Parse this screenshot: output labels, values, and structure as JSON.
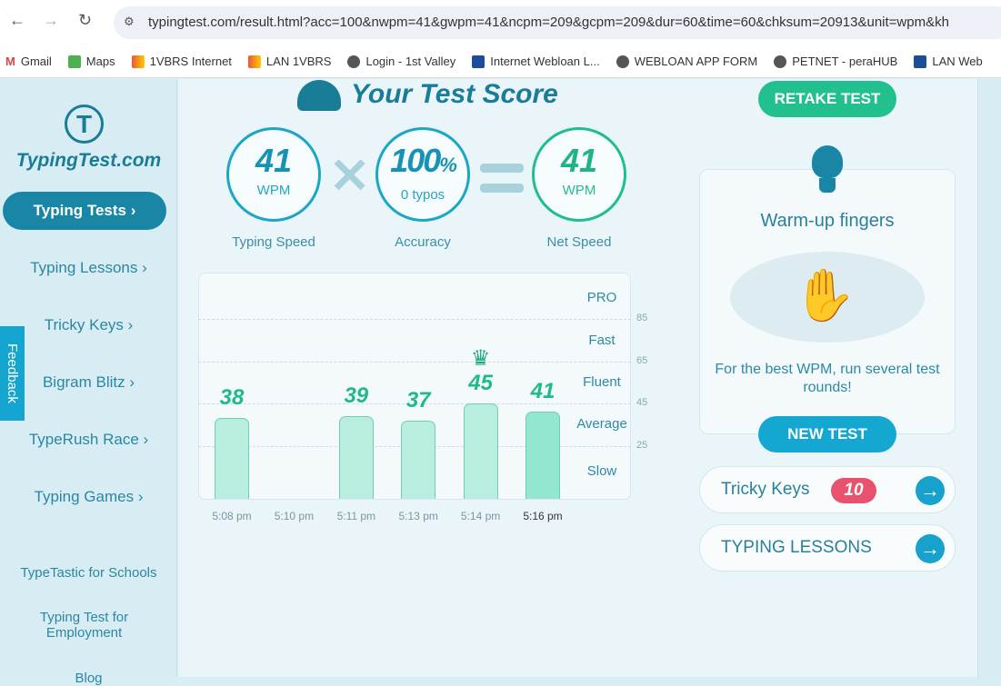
{
  "browser": {
    "url": "typingtest.com/result.html?acc=100&nwpm=41&gwpm=41&ncpm=209&gcpm=209&dur=60&time=60&chksum=20913&unit=wpm&kh",
    "bookmarks": [
      "Gmail",
      "Maps",
      "1VBRS Internet",
      "LAN 1VBRS",
      "Login - 1st Valley",
      "Internet Webloan L...",
      "WEBLOAN APP FORM",
      "PETNET - peraHUB",
      "LAN Web"
    ]
  },
  "sidebar": {
    "logo": "TypingTest.com",
    "items": [
      "Typing Tests",
      "Typing Lessons",
      "Tricky Keys",
      "Bigram Blitz",
      "TypeRush Race",
      "Typing Games"
    ],
    "links": [
      "TypeTastic for Schools",
      "Typing Test for Employment",
      "Blog"
    ],
    "feedback": "Feedback"
  },
  "score": {
    "title": "Your Test Score",
    "speed": {
      "value": "41",
      "unit": "WPM",
      "label": "Typing Speed"
    },
    "accuracy": {
      "value": "100",
      "pct": "%",
      "sub": "0 typos",
      "label": "Accuracy"
    },
    "net": {
      "value": "41",
      "unit": "WPM",
      "label": "Net Speed"
    }
  },
  "chart_data": {
    "type": "bar",
    "categories": [
      "5:08 pm",
      "5:10 pm",
      "5:11 pm",
      "5:13 pm",
      "5:14 pm",
      "5:16 pm"
    ],
    "values": [
      38,
      null,
      39,
      37,
      45,
      41
    ],
    "best_index": 4,
    "current_index": 5,
    "ylim": [
      0,
      105
    ],
    "yticks": [
      25,
      45,
      65,
      85
    ],
    "zones": [
      "PRO",
      "Fast",
      "Fluent",
      "Average",
      "Slow"
    ]
  },
  "right": {
    "retake": "RETAKE TEST",
    "tip_title": "Warm-up fingers",
    "tip_text": "For the best WPM, run several test rounds!",
    "new_test": "NEW TEST",
    "tricky": "Tricky Keys",
    "tricky_count": "10",
    "lessons": "TYPING LESSONS"
  }
}
